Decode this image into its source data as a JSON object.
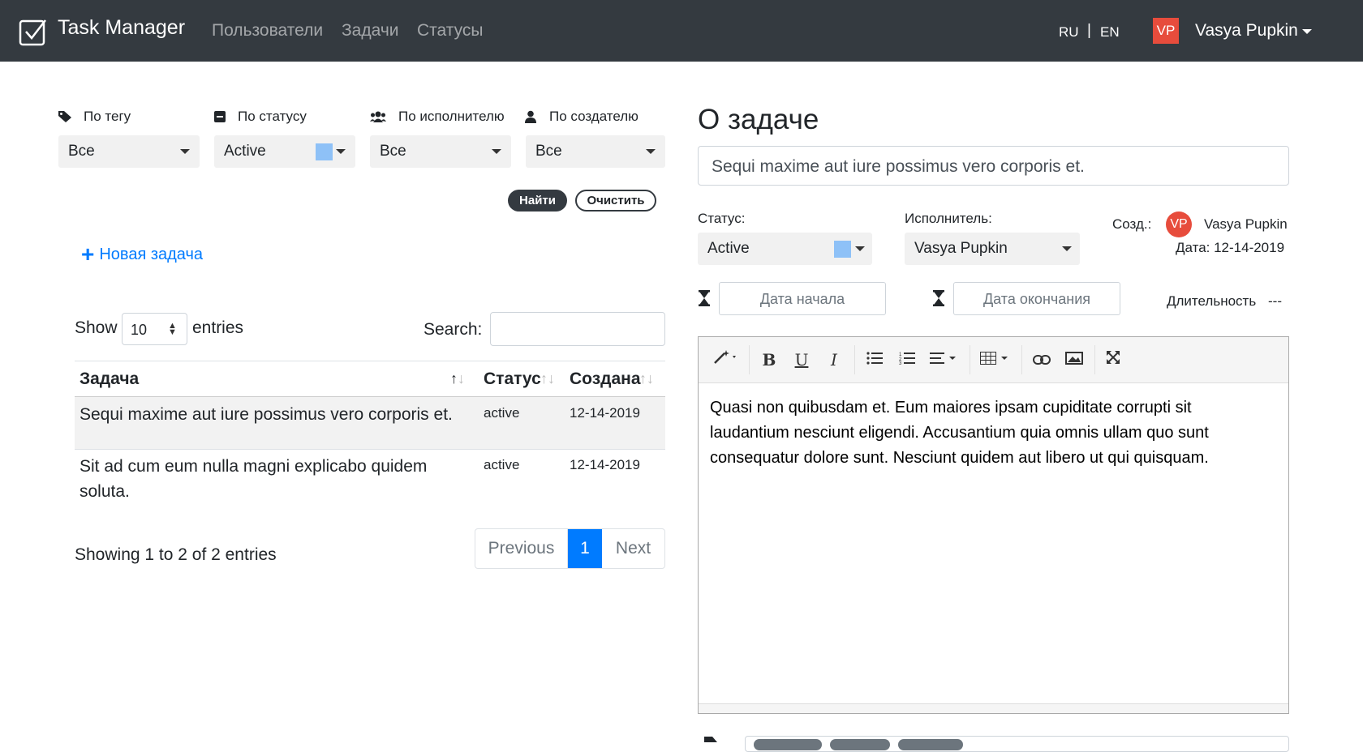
{
  "navbar": {
    "brand": "Task Manager",
    "links": [
      "Пользователи",
      "Задачи",
      "Статусы"
    ],
    "lang_ru": "RU",
    "lang_sep": "|",
    "lang_en": "EN",
    "avatar": "VP",
    "user": "Vasya Pupkin"
  },
  "filters": {
    "tag": {
      "label": "По тегу",
      "value": "Все",
      "icon": "tag-icon"
    },
    "status": {
      "label": "По статусу",
      "value": "Active",
      "icon": "status-icon",
      "color": "#8ec1f7"
    },
    "assignee": {
      "label": "По исполнителю",
      "value": "Все",
      "icon": "users-icon"
    },
    "creator": {
      "label": "По создателю",
      "value": "Все",
      "icon": "user-icon"
    },
    "find": "Найти",
    "clear": "Очистить"
  },
  "new_task": {
    "plus": "+",
    "label": "Новая задача"
  },
  "table": {
    "show": "Show",
    "length": "10",
    "entries": "entries",
    "search_label": "Search:",
    "search_value": "",
    "headers": [
      "Задача",
      "Статус",
      "Создана"
    ],
    "rows": [
      {
        "task": "Sequi maxime aut iure possimus vero corporis et.",
        "status": "active",
        "created": "12-14-2019"
      },
      {
        "task_line1": "Sit ad cum eum nulla magni explicabo quidem",
        "task_line2": "soluta.",
        "status": "active",
        "created": "12-14-2019"
      }
    ],
    "info": "Showing 1 to 2 of 2 entries",
    "pager": {
      "prev": "Previous",
      "current": "1",
      "next": "Next"
    }
  },
  "task": {
    "heading": "О задаче",
    "title": "Sequi maxime aut iure possimus vero corporis et.",
    "status_label": "Статус:",
    "status_value": "Active",
    "status_color": "#8ec1f7",
    "assignee_label": "Исполнитель:",
    "assignee_value": "Vasya Pupkin",
    "creator_label": "Созд.:",
    "creator_avatar": "VP",
    "creator_name": "Vasya Pupkin",
    "date_text": "Дата: 12-14-2019",
    "start_placeholder": "Дата начала",
    "end_placeholder": "Дата окончания",
    "duration_label": "Длительность",
    "duration_value": "---",
    "description": "Quasi non quibusdam et. Eum maiores ipsam cupiditate corrupti sit laudantium nesciunt eligendi. Accusantium quia omnis ullam quo sunt consequatur dolore sunt. Nesciunt quidem aut libero ut qui quisquam."
  },
  "editor_toolbar": [
    "magic-icon",
    "bold-icon",
    "underline-icon",
    "italic-icon",
    "unordered-list-icon",
    "ordered-list-icon",
    "align-icon",
    "table-icon",
    "link-icon",
    "image-icon",
    "fullscreen-icon"
  ]
}
